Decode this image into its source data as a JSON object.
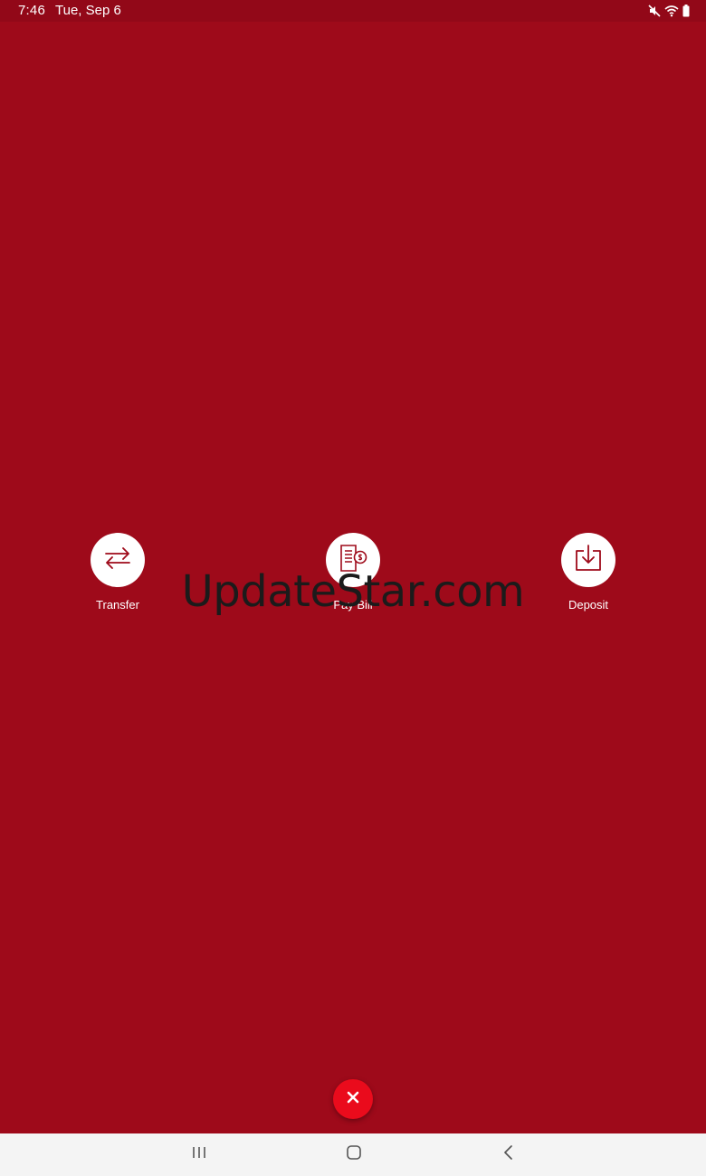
{
  "status_bar": {
    "time": "7:46",
    "date": "Tue, Sep 6",
    "icons": [
      "mute-icon",
      "wifi-icon",
      "battery-icon"
    ]
  },
  "actions": [
    {
      "label": "Transfer",
      "icon": "transfer-arrows-icon"
    },
    {
      "label": "Pay Bill",
      "icon": "bill-icon"
    },
    {
      "label": "Deposit",
      "icon": "deposit-icon"
    }
  ],
  "watermark": "UpdateStar.com",
  "close_button": {
    "icon": "close-icon"
  },
  "nav_bar": {
    "icons": [
      "recent-apps-icon",
      "home-icon",
      "back-icon"
    ]
  },
  "colors": {
    "background": "#9e0a1a",
    "status_bar": "#920818",
    "fab": "#ea0b1c",
    "icon_stroke": "#9e0a1a",
    "nav_bar": "#f4f4f4"
  }
}
